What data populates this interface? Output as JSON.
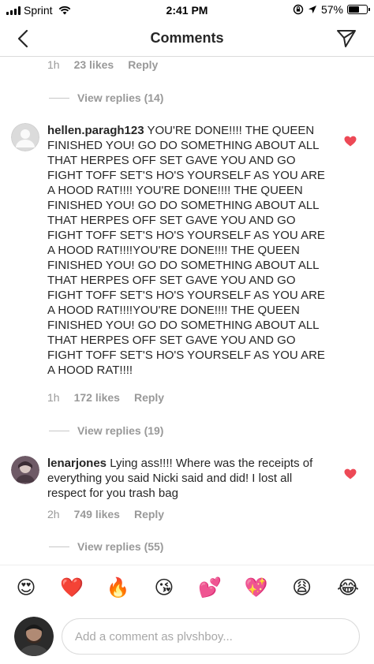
{
  "status_bar": {
    "carrier": "Sprint",
    "time": "2:41 PM",
    "battery": "57%",
    "battery_level": 0.57
  },
  "nav": {
    "title": "Comments",
    "back_icon": "chevron-left-icon",
    "send_icon": "paper-plane-icon"
  },
  "top_partial": {
    "time": "1h",
    "likes": "23 likes",
    "reply": "Reply",
    "view_replies": "View replies (14)"
  },
  "comments": [
    {
      "username": "hellen.paragh123",
      "text": "YOU'RE DONE!!!! THE QUEEN FINISHED YOU! GO DO SOMETHING ABOUT ALL THAT HERPES OFF SET GAVE YOU AND GO FIGHT TOFF SET'S HO'S YOURSELF AS YOU ARE A HOOD RAT!!!! YOU'RE DONE!!!! THE QUEEN FINISHED YOU! GO DO SOMETHING ABOUT ALL THAT HERPES OFF SET GAVE YOU AND GO FIGHT TOFF SET'S HO'S YOURSELF AS YOU ARE A HOOD RAT!!!!YOU'RE DONE!!!! THE QUEEN FINISHED YOU! GO DO SOMETHING ABOUT ALL THAT HERPES OFF SET GAVE YOU AND GO FIGHT TOFF SET'S HO'S YOURSELF AS YOU ARE A HOOD RAT!!!!YOU'RE DONE!!!! THE QUEEN FINISHED YOU! GO DO SOMETHING ABOUT ALL THAT HERPES OFF SET GAVE YOU AND GO FIGHT TOFF SET'S HO'S YOURSELF AS YOU ARE A HOOD RAT!!!!",
      "time": "1h",
      "likes": "172 likes",
      "reply": "Reply",
      "view_replies": "View replies (19)"
    },
    {
      "username": "lenarjones",
      "text": "Lying ass!!!! Where was the receipts of everything you said Nicki said and did! I lost all respect for you trash bag",
      "time": "2h",
      "likes": "749 likes",
      "reply": "Reply",
      "view_replies": "View replies (55)"
    }
  ],
  "emoji_bar": [
    "😍",
    "❤️",
    "🔥",
    "😘",
    "💕",
    "💖",
    "😩",
    "😂"
  ],
  "input": {
    "placeholder": "Add a comment as plvshboy..."
  },
  "colors": {
    "heart": "#ed4956",
    "meta_text": "#999999",
    "divider": "#dbdbdb"
  }
}
